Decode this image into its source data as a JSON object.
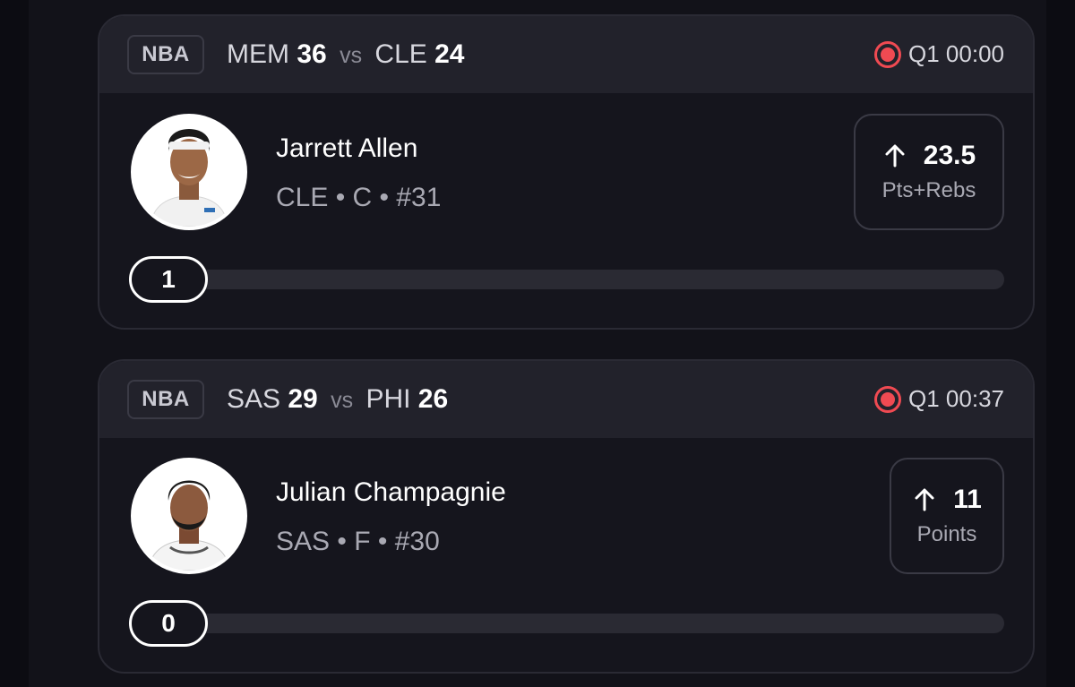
{
  "colors": {
    "background": "#121219",
    "card": "#15151d",
    "header": "#22222b",
    "live": "#f04a52",
    "text_secondary": "#a9a9b3"
  },
  "cards": [
    {
      "league": "NBA",
      "away_team": "MEM",
      "away_score": "36",
      "vs": "vs",
      "home_team": "CLE",
      "home_score": "24",
      "status": "Q1 00:00",
      "player_name": "Jarrett Allen",
      "player_meta": "CLE • C • #31",
      "direction_icon": "arrow-up-icon",
      "line": "23.5",
      "stat_type": "Pts+Rebs",
      "current": "1",
      "progress_fraction": 0
    },
    {
      "league": "NBA",
      "away_team": "SAS",
      "away_score": "29",
      "vs": "vs",
      "home_team": "PHI",
      "home_score": "26",
      "status": "Q1 00:37",
      "player_name": "Julian Champagnie",
      "player_meta": "SAS • F • #30",
      "direction_icon": "arrow-up-icon",
      "line": "11",
      "stat_type": "Points",
      "current": "0",
      "progress_fraction": 0
    }
  ]
}
